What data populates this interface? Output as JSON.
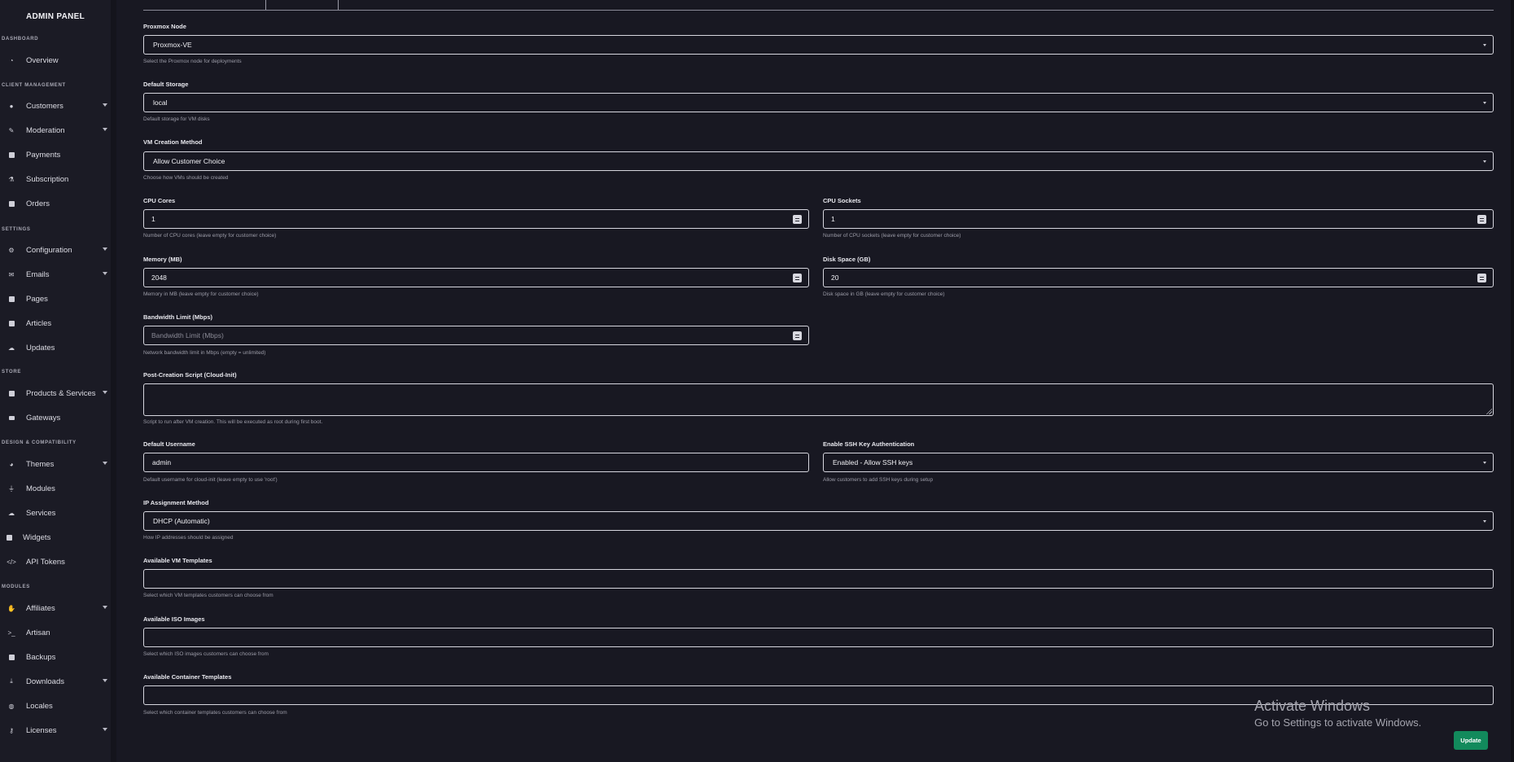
{
  "sidebar": {
    "title": "ADMIN PANEL",
    "sections": {
      "dashboard": "DASHBOARD",
      "client": "CLIENT MANAGEMENT",
      "settings": "SETTINGS",
      "store": "STORE",
      "design": "DESIGN & COMPATIBILITY",
      "modules": "MODULES"
    },
    "items": {
      "overview": "Overview",
      "customers": "Customers",
      "moderation": "Moderation",
      "payments": "Payments",
      "subscription": "Subscription",
      "orders": "Orders",
      "configuration": "Configuration",
      "emails": "Emails",
      "pages": "Pages",
      "articles": "Articles",
      "updates": "Updates",
      "products": "Products & Services",
      "gateways": "Gateways",
      "themes": "Themes",
      "modules": "Modules",
      "services": "Services",
      "widgets": "Widgets",
      "api_tokens": "API Tokens",
      "affiliates": "Affiliates",
      "artisan": "Artisan",
      "backups": "Backups",
      "downloads": "Downloads",
      "locales": "Locales",
      "licenses": "Licenses"
    }
  },
  "form": {
    "proxmox_node": {
      "label": "Proxmox Node",
      "value": "Proxmox-VE",
      "hint": "Select the Proxmox node for deployments"
    },
    "default_storage": {
      "label": "Default Storage",
      "value": "local",
      "hint": "Default storage for VM disks"
    },
    "vm_creation": {
      "label": "VM Creation Method",
      "value": "Allow Customer Choice",
      "hint": "Choose how VMs should be created"
    },
    "cpu_cores": {
      "label": "CPU Cores",
      "value": "1",
      "hint": "Number of CPU cores (leave empty for customer choice)"
    },
    "cpu_sockets": {
      "label": "CPU Sockets",
      "value": "1",
      "hint": "Number of CPU sockets (leave empty for customer choice)"
    },
    "memory": {
      "label": "Memory (MB)",
      "value": "2048",
      "hint": "Memory in MB (leave empty for customer choice)"
    },
    "disk": {
      "label": "Disk Space (GB)",
      "value": "20",
      "hint": "Disk space in GB (leave empty for customer choice)"
    },
    "bandwidth": {
      "label": "Bandwidth Limit (Mbps)",
      "placeholder": "Bandwidth Limit (Mbps)",
      "hint": "Network bandwidth limit in Mbps (empty = unlimited)"
    },
    "post_script": {
      "label": "Post-Creation Script (Cloud-Init)",
      "value": "",
      "hint": "Script to run after VM creation. This will be executed as root during first boot."
    },
    "username": {
      "label": "Default Username",
      "value": "admin",
      "hint": "Default username for cloud-init (leave empty to use 'root')"
    },
    "ssh": {
      "label": "Enable SSH Key Authentication",
      "value": "Enabled - Allow SSH keys",
      "hint": "Allow customers to add SSH keys during setup"
    },
    "ip_method": {
      "label": "IP Assignment Method",
      "value": "DHCP (Automatic)",
      "hint": "How IP addresses should be assigned"
    },
    "vm_templates": {
      "label": "Available VM Templates",
      "value": "",
      "hint": "Select which VM templates customers can choose from"
    },
    "iso_images": {
      "label": "Available ISO Images",
      "value": "",
      "hint": "Select which ISO images customers can choose from"
    },
    "container_templates": {
      "label": "Available Container Templates",
      "value": "",
      "hint": "Select which container templates customers can choose from"
    }
  },
  "actions": {
    "update": "Update"
  },
  "watermark": {
    "line1": "Activate Windows",
    "line2": "Go to Settings to activate Windows."
  },
  "colors": {
    "background": "#181822",
    "sidebar": "#1b1b25",
    "accent": "#128a5c"
  }
}
